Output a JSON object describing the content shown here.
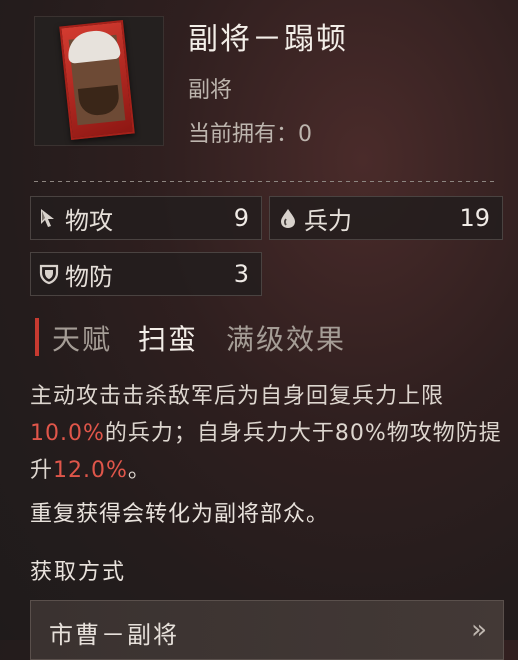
{
  "header": {
    "title": "副将－蹋顿",
    "subtitle": "副将",
    "owned_label": "当前拥有：",
    "owned_count": "0"
  },
  "stats": [
    {
      "label": "物攻",
      "value": "9",
      "icon": "sword-cursor-icon"
    },
    {
      "label": "兵力",
      "value": "19",
      "icon": "drop-icon"
    },
    {
      "label": "物防",
      "value": "3",
      "icon": "shield-icon"
    }
  ],
  "talent": {
    "label": "天赋",
    "name": "扫蛮",
    "max_effect_label": "满级效果"
  },
  "description": {
    "part1": "主动攻击击杀敌军后为自身回复兵力上限",
    "value1": "10.0%",
    "part2": "的兵力；自身兵力大于80%物攻物防提升",
    "value2": "12.0%",
    "part3": "。"
  },
  "conversion_note": "重复获得会转化为副将部众。",
  "acquisition": {
    "title": "获取方式",
    "source": "市曹－副将"
  },
  "colors": {
    "highlight": "#e0564a",
    "accent_bar": "#c73a30"
  }
}
